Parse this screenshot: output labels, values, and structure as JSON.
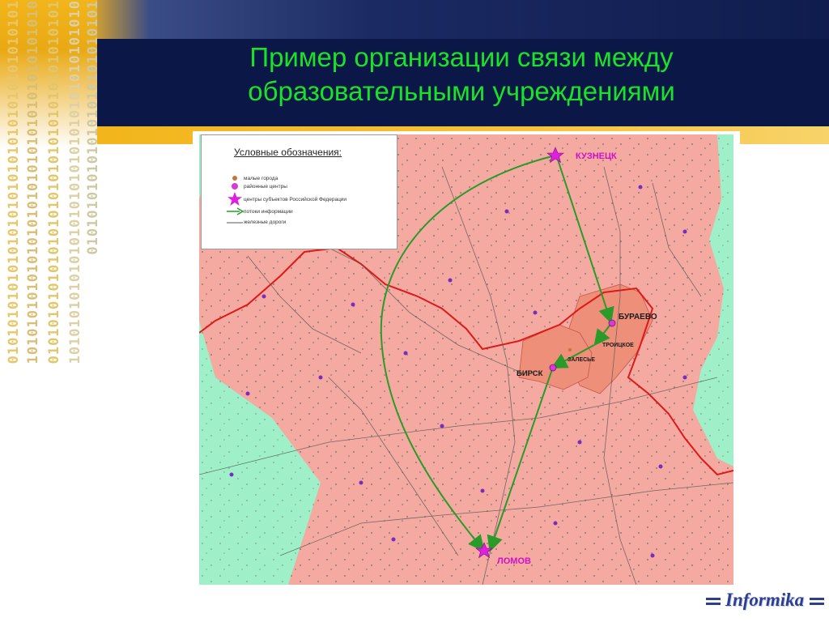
{
  "title": {
    "line1": "Пример организации связи между",
    "line2": "образовательными учреждениями"
  },
  "legend": {
    "heading": "Условные обозначения:",
    "items": [
      {
        "icon": "small-town-dot",
        "label": "малые города",
        "color": "#c8743a"
      },
      {
        "icon": "district-center-dot",
        "label": "районные центры",
        "color": "#d43cd4"
      },
      {
        "icon": "star-icon",
        "label": "центры субъектов Российской Федерации",
        "color": "#e01ee0"
      },
      {
        "icon": "arrow-icon",
        "label": "потоки информации",
        "color": "#2a9a2a"
      },
      {
        "icon": "railway-line",
        "label": "железные дороги",
        "color": "#555555"
      }
    ]
  },
  "map": {
    "cities": {
      "kuznetsk": "КУЗНЕЦК",
      "buraevo": "БУРАЕВО",
      "troitskoe": "ТРОИЦКОЕ",
      "zalesye": "ЗАЛЕСЬЕ",
      "birsk": "БИРСК",
      "lomov": "ЛОМОВ"
    },
    "colors": {
      "region": "#f4aaa0",
      "outside": "#9ff0c8",
      "highlight": "#ee8f7a",
      "border": "#e01818",
      "flow": "#2a9a2a",
      "city_label": "#d011c9"
    }
  },
  "logo": {
    "text": "Informika"
  }
}
